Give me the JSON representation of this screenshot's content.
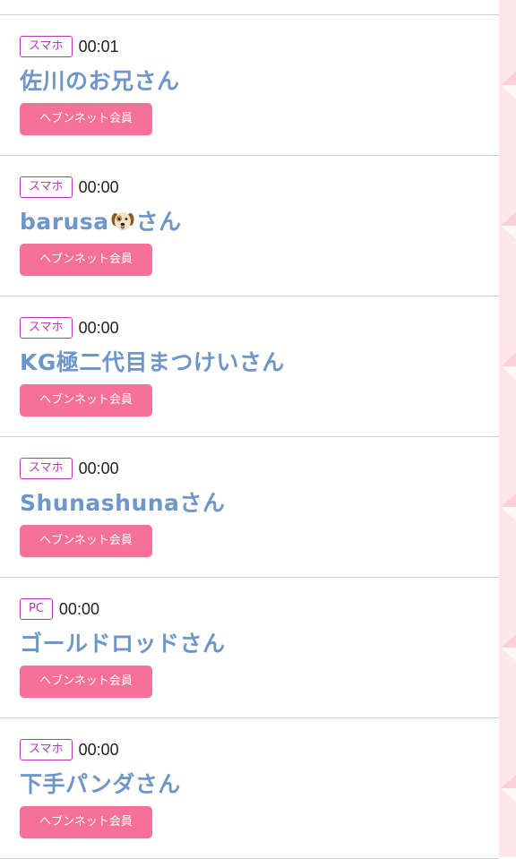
{
  "colors": {
    "badge_border": "#b23bb5",
    "name_text": "#6e96c9",
    "member_button_bg": "#f6709a",
    "side_strip_bg": "#fde7ea"
  },
  "visitors": [
    {
      "device": "スマホ",
      "time": "00:01",
      "name": "佐川のお兄さん",
      "member_label": "ヘブンネット会員"
    },
    {
      "device": "スマホ",
      "time": "00:00",
      "name_prefix": "barusa",
      "name_icon": "dog-face-emoji",
      "name_suffix": "さん",
      "member_label": "ヘブンネット会員"
    },
    {
      "device": "スマホ",
      "time": "00:00",
      "name": "KG極二代目まつけいさん",
      "member_label": "ヘブンネット会員"
    },
    {
      "device": "スマホ",
      "time": "00:00",
      "name": "Shunashunaさん",
      "member_label": "ヘブンネット会員"
    },
    {
      "device": "PC",
      "time": "00:00",
      "name": "ゴールドロッドさん",
      "member_label": "ヘブンネット会員"
    },
    {
      "device": "スマホ",
      "time": "00:00",
      "name": "下手パンダさん",
      "member_label": "ヘブンネット会員"
    }
  ]
}
